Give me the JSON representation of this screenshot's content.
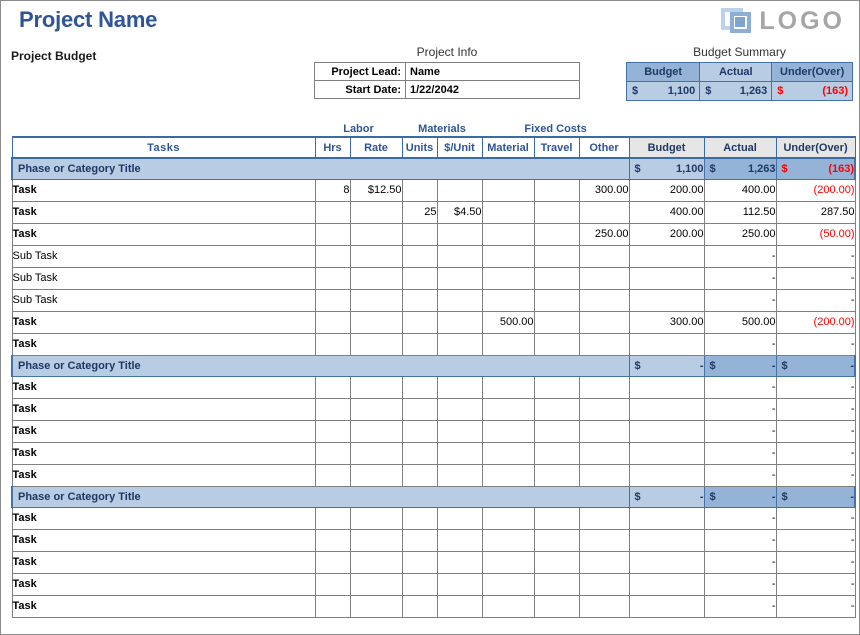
{
  "header": {
    "project_title": "Project Name",
    "subtitle": "Project Budget",
    "logo_text": "LOGO",
    "logo_mark": "overlapping-squares-icon"
  },
  "project_info": {
    "caption": "Project Info",
    "rows": [
      {
        "label": "Project Lead:",
        "value": "Name"
      },
      {
        "label": "Start Date:",
        "value": "1/22/2042"
      }
    ]
  },
  "budget_summary": {
    "caption": "Budget Summary",
    "headers": [
      "Budget",
      "Actual",
      "Under(Over)"
    ],
    "currency": "$",
    "values": [
      "1,100",
      "1,263",
      "(163)"
    ],
    "negative_color": "#ff0000"
  },
  "table": {
    "group_labels": [
      "Labor",
      "Materials",
      "Fixed Costs"
    ],
    "columns": [
      "Tasks",
      "Hrs",
      "Rate",
      "Units",
      "$/Unit",
      "Material",
      "Travel",
      "Other",
      "Budget",
      "Actual",
      "Under(Over)"
    ],
    "currency": "$",
    "sections": [
      {
        "phase_title": "Phase or Category Title",
        "phase_budget": "1,100",
        "phase_actual": "1,263",
        "phase_under_over": "(163)",
        "phase_under_over_negative": true,
        "rows": [
          {
            "name": "Task",
            "sub": false,
            "hrs": "8",
            "rate": "$12.50",
            "units": "",
            "unit_cost": "",
            "material": "",
            "travel": "",
            "other": "300.00",
            "budget": "200.00",
            "actual": "400.00",
            "under_over": "(200.00)",
            "negative": true
          },
          {
            "name": "Task",
            "sub": false,
            "hrs": "",
            "rate": "",
            "units": "25",
            "unit_cost": "$4.50",
            "material": "",
            "travel": "",
            "other": "",
            "budget": "400.00",
            "actual": "112.50",
            "under_over": "287.50",
            "negative": false
          },
          {
            "name": "Task",
            "sub": false,
            "hrs": "",
            "rate": "",
            "units": "",
            "unit_cost": "",
            "material": "",
            "travel": "",
            "other": "250.00",
            "budget": "200.00",
            "actual": "250.00",
            "under_over": "(50.00)",
            "negative": true
          },
          {
            "name": "Sub Task",
            "sub": true,
            "hrs": "",
            "rate": "",
            "units": "",
            "unit_cost": "",
            "material": "",
            "travel": "",
            "other": "",
            "budget": "",
            "actual": "-",
            "under_over": "-",
            "negative": false
          },
          {
            "name": "Sub Task",
            "sub": true,
            "hrs": "",
            "rate": "",
            "units": "",
            "unit_cost": "",
            "material": "",
            "travel": "",
            "other": "",
            "budget": "",
            "actual": "-",
            "under_over": "-",
            "negative": false
          },
          {
            "name": "Sub Task",
            "sub": true,
            "hrs": "",
            "rate": "",
            "units": "",
            "unit_cost": "",
            "material": "",
            "travel": "",
            "other": "",
            "budget": "",
            "actual": "-",
            "under_over": "-",
            "negative": false
          },
          {
            "name": "Task",
            "sub": false,
            "hrs": "",
            "rate": "",
            "units": "",
            "unit_cost": "",
            "material": "500.00",
            "travel": "",
            "other": "",
            "budget": "300.00",
            "actual": "500.00",
            "under_over": "(200.00)",
            "negative": true
          },
          {
            "name": "Task",
            "sub": false,
            "hrs": "",
            "rate": "",
            "units": "",
            "unit_cost": "",
            "material": "",
            "travel": "",
            "other": "",
            "budget": "",
            "actual": "-",
            "under_over": "-",
            "negative": false
          }
        ]
      },
      {
        "phase_title": "Phase or Category Title",
        "phase_budget": "-",
        "phase_actual": "-",
        "phase_under_over": "-",
        "phase_under_over_negative": false,
        "rows": [
          {
            "name": "Task",
            "sub": false,
            "hrs": "",
            "rate": "",
            "units": "",
            "unit_cost": "",
            "material": "",
            "travel": "",
            "other": "",
            "budget": "",
            "actual": "-",
            "under_over": "-",
            "negative": false
          },
          {
            "name": "Task",
            "sub": false,
            "hrs": "",
            "rate": "",
            "units": "",
            "unit_cost": "",
            "material": "",
            "travel": "",
            "other": "",
            "budget": "",
            "actual": "-",
            "under_over": "-",
            "negative": false
          },
          {
            "name": "Task",
            "sub": false,
            "hrs": "",
            "rate": "",
            "units": "",
            "unit_cost": "",
            "material": "",
            "travel": "",
            "other": "",
            "budget": "",
            "actual": "-",
            "under_over": "-",
            "negative": false
          },
          {
            "name": "Task",
            "sub": false,
            "hrs": "",
            "rate": "",
            "units": "",
            "unit_cost": "",
            "material": "",
            "travel": "",
            "other": "",
            "budget": "",
            "actual": "-",
            "under_over": "-",
            "negative": false
          },
          {
            "name": "Task",
            "sub": false,
            "hrs": "",
            "rate": "",
            "units": "",
            "unit_cost": "",
            "material": "",
            "travel": "",
            "other": "",
            "budget": "",
            "actual": "-",
            "under_over": "-",
            "negative": false
          }
        ]
      },
      {
        "phase_title": "Phase or Category Title",
        "phase_budget": "-",
        "phase_actual": "-",
        "phase_under_over": "-",
        "phase_under_over_negative": false,
        "rows": [
          {
            "name": "Task",
            "sub": false,
            "hrs": "",
            "rate": "",
            "units": "",
            "unit_cost": "",
            "material": "",
            "travel": "",
            "other": "",
            "budget": "",
            "actual": "-",
            "under_over": "-",
            "negative": false
          },
          {
            "name": "Task",
            "sub": false,
            "hrs": "",
            "rate": "",
            "units": "",
            "unit_cost": "",
            "material": "",
            "travel": "",
            "other": "",
            "budget": "",
            "actual": "-",
            "under_over": "-",
            "negative": false
          },
          {
            "name": "Task",
            "sub": false,
            "hrs": "",
            "rate": "",
            "units": "",
            "unit_cost": "",
            "material": "",
            "travel": "",
            "other": "",
            "budget": "",
            "actual": "-",
            "under_over": "-",
            "negative": false
          },
          {
            "name": "Task",
            "sub": false,
            "hrs": "",
            "rate": "",
            "units": "",
            "unit_cost": "",
            "material": "",
            "travel": "",
            "other": "",
            "budget": "",
            "actual": "-",
            "under_over": "-",
            "negative": false
          },
          {
            "name": "Task",
            "sub": false,
            "hrs": "",
            "rate": "",
            "units": "",
            "unit_cost": "",
            "material": "",
            "travel": "",
            "other": "",
            "budget": "",
            "actual": "-",
            "under_over": "-",
            "negative": false
          }
        ]
      }
    ]
  },
  "colors": {
    "title_blue": "#2f5597",
    "phase_light": "#b8cce4",
    "phase_dark": "#95b3d7",
    "calc_gray": "#e6e6e6",
    "negative": "#ff0000"
  }
}
